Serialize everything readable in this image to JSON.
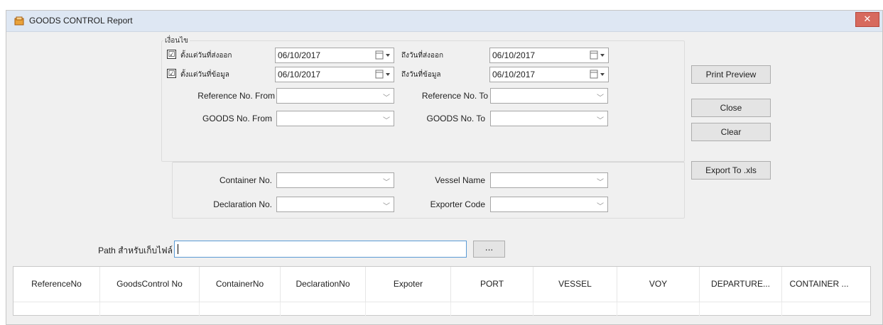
{
  "window": {
    "title": "GOODS CONTROL Report",
    "close_glyph": "✕"
  },
  "filters": {
    "group_label": "เงื่อนไข",
    "date_from_label": "ตั้งแต่วันที่ส่งออก",
    "date_to_label": "ถึงวันที่ส่งออก",
    "data_from_label": "ตั้งแต่วันที่ข้อมูล",
    "data_to_label": "ถึงวันที่ข้อมูล",
    "date_from_value": "06/10/2017",
    "date_to_value": "06/10/2017",
    "data_from_value": "06/10/2017",
    "data_to_value": "06/10/2017",
    "date_check_1": "☑",
    "date_check_2": "☑",
    "ref_from_label": "Reference No. From",
    "ref_to_label": "Reference No. To",
    "goods_from_label": "GOODS No. From",
    "goods_to_label": "GOODS No. To",
    "container_label": "Container No.",
    "vessel_label": "Vessel Name",
    "declaration_label": "Declaration No.",
    "exporter_label": "Exporter Code"
  },
  "buttons": {
    "print_preview": "Print Preview",
    "close": "Close",
    "clear": "Clear",
    "export": "Export To .xls"
  },
  "path": {
    "label": "Path สำหรับเก็บไฟล์",
    "value": "",
    "browse": "..."
  },
  "grid": {
    "columns": [
      "ReferenceNo",
      "GoodsControl No",
      "ContainerNo",
      "DeclarationNo",
      "Expoter",
      "PORT",
      "VESSEL",
      "VOY",
      "DEPARTURE...",
      "CONTAINER ..."
    ]
  },
  "colors": {
    "accent": "#5b9bd5",
    "close": "#d76a5e",
    "titlebar": "#dee7f3"
  },
  "icons": {
    "app": "app-icon",
    "calendar": "calendar-icon",
    "dropdown": "chevron-down-icon"
  }
}
